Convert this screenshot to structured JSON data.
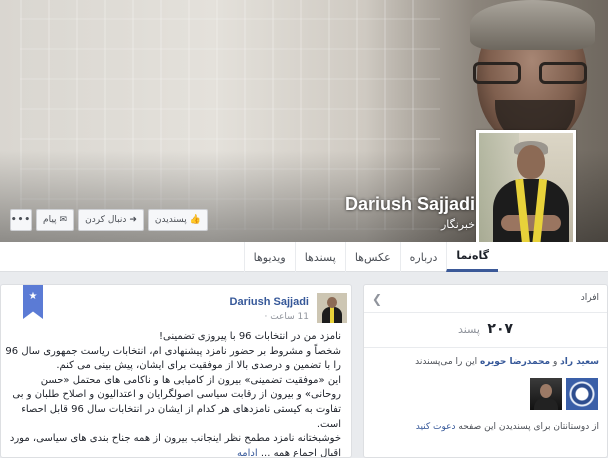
{
  "profile": {
    "name": "Dariush Sajjadi",
    "category": "خبرنگار"
  },
  "cover_buttons": {
    "like": "پسندیدن",
    "follow": "دنبال کردن",
    "message": "پیام",
    "more": "•••"
  },
  "tabs": [
    {
      "label": "گاه‌نما",
      "active": true
    },
    {
      "label": "درباره",
      "active": false
    },
    {
      "label": "عکس‌ها",
      "active": false
    },
    {
      "label": "پسندها",
      "active": false
    },
    {
      "label": "ویدیوها",
      "active": false
    }
  ],
  "likes": {
    "title": "افراد",
    "count": "۲۰۷",
    "count_label": "پسند",
    "friend1": "سعید راد",
    "and": " و ",
    "friend2": "محمدرضا حویره",
    "friends_suffix": " این را می‌پسندند",
    "invite_prefix": "از دوستانتان برای پسندیدن این صفحه ",
    "invite_link": "دعوت کنید"
  },
  "post": {
    "author": "Dariush Sajjadi",
    "time": "11 ساعت ·",
    "lines": [
      "نامزد من در انتخابات 96 با پیروزی تضمینی!",
      "شخصاً و مشروط بر حضور نامزد پیشنهادی ام، انتخابات ریاست جمهوری سال 96 را با تضمین و درصدی بالا از موفقیت برای ایشان، پیش بینی می کنم.",
      "این «موفقیت تضمینی» بیرون از کامیابی ها و ناکامی های محتمل «حسن روحانی» و بیرون از رقابت سیاسی اصولگرایان و اعتدالیون و اصلاح طلبان و بی تفاوت به کیستی نامزدهای هر کدام از ایشان در انتخابات سال 96 قابل احصاء است.",
      "خوشبختانه نامزد مطمح نظر اینجانب بیرون از همه جناح بندی های سیاسی، مورد اقبال اجماع همه ..."
    ],
    "more": "ادامه"
  },
  "colors": {
    "facebook_blue": "#3b5998",
    "link_blue": "#365899",
    "background": "#e9ebee"
  }
}
